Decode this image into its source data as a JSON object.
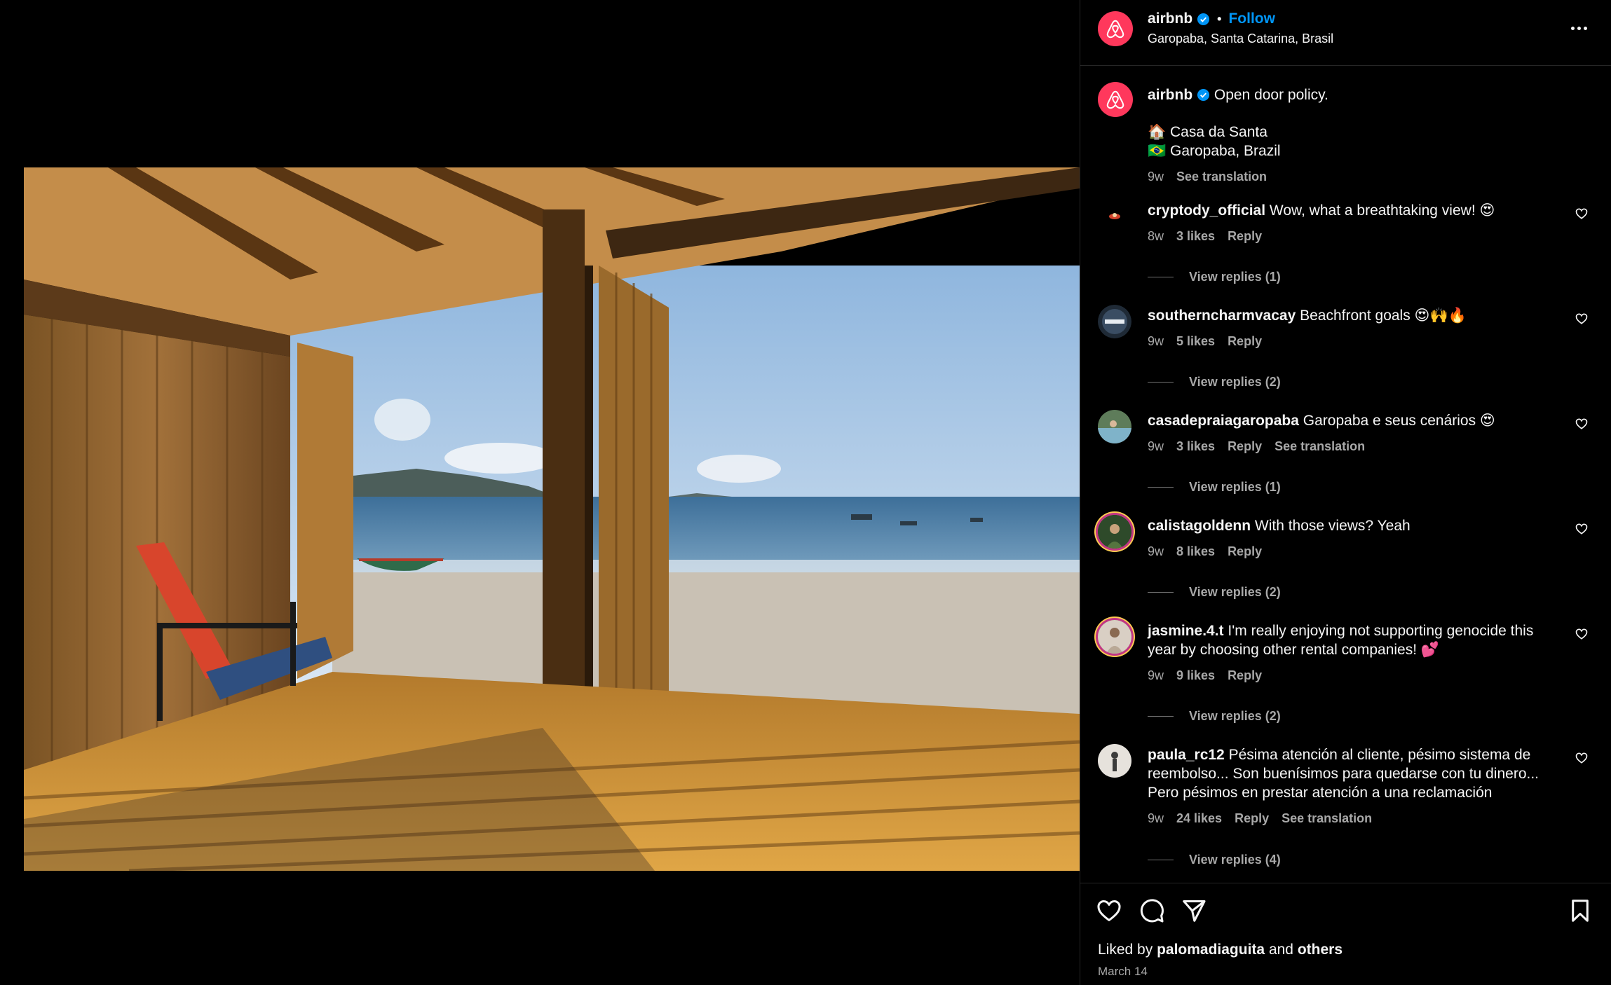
{
  "colors": {
    "brand": "#ff385c",
    "link": "#0095f6",
    "muted": "#a8a8a8",
    "background": "#000000"
  },
  "post": {
    "username": "airbnb",
    "separator": "•",
    "follow_label": "Follow",
    "location": "Garopaba, Santa Catarina, Brasil",
    "more_icon": "more-horizontal-icon",
    "image_icon": "beach-house-photo"
  },
  "caption": {
    "username": "airbnb",
    "text": "Open door policy.",
    "line1": "🏠 Casa da Santa",
    "line2": "🇧🇷 Garopaba, Brazil",
    "time": "9w",
    "translate_label": "See translation"
  },
  "comments": [
    {
      "username": "cryptody_official",
      "text": "Wow, what a breathtaking view! 😍",
      "time": "8w",
      "likes": "3 likes",
      "reply": "Reply",
      "translate": "",
      "replies": "View replies (1)"
    },
    {
      "username": "southerncharmvacay",
      "text": "Beachfront goals 😍🙌🔥",
      "time": "9w",
      "likes": "5 likes",
      "reply": "Reply",
      "translate": "",
      "replies": "View replies (2)"
    },
    {
      "username": "casadepraiagaropaba",
      "text": "Garopaba e seus cenários 😍",
      "time": "9w",
      "likes": "3 likes",
      "reply": "Reply",
      "translate": "See translation",
      "replies": "View replies (1)"
    },
    {
      "username": "calistagoldenn",
      "text": "With those views? Yeah",
      "time": "9w",
      "likes": "8 likes",
      "reply": "Reply",
      "translate": "",
      "replies": "View replies (2)"
    },
    {
      "username": "jasmine.4.t",
      "text": "I'm really enjoying not supporting genocide this year by choosing other rental companies! 💕",
      "time": "9w",
      "likes": "9 likes",
      "reply": "Reply",
      "translate": "",
      "replies": "View replies (2)"
    },
    {
      "username": "paula_rc12",
      "text": "Pésima atención al cliente, pésimo sistema de reembolso... Son buenísimos para quedarse con tu dinero... Pero pésimos en prestar atención a una reclamación",
      "time": "9w",
      "likes": "24 likes",
      "reply": "Reply",
      "translate": "See translation",
      "replies": "View replies (4)"
    }
  ],
  "footer": {
    "liked_prefix": "Liked by",
    "liked_user": "palomadiaguita",
    "liked_and": "and",
    "liked_others": "others",
    "date": "March 14"
  }
}
